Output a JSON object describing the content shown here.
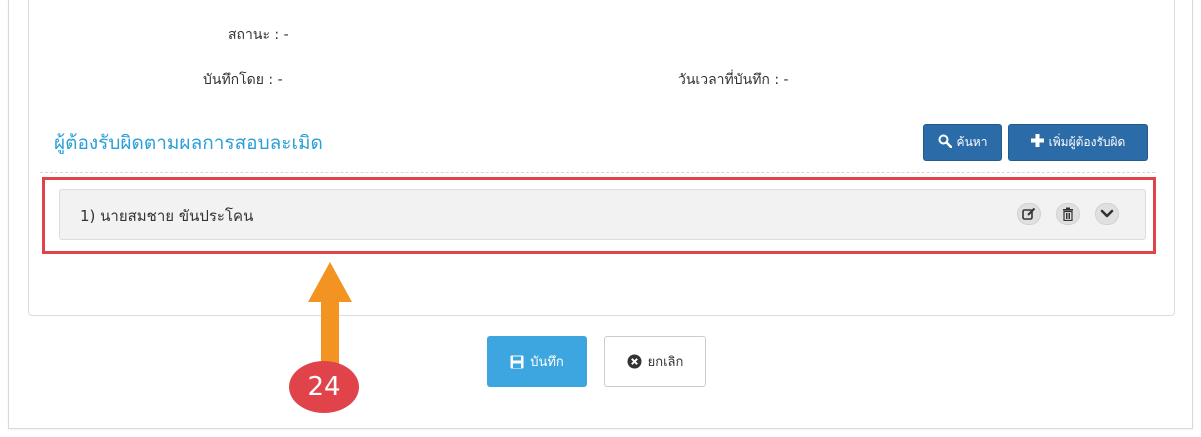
{
  "form": {
    "status_label": "สถานะ : -",
    "recorded_by_label": "บันทึกโดย : -",
    "recorded_at_label": "วันเวลาที่บันทึก : -"
  },
  "section": {
    "title": "ผู้ต้องรับผิดตามผลการสอบละเมิด",
    "search_label": "ค้นหา",
    "add_label": "เพิ่มผู้ต้องรับผิด"
  },
  "persons": [
    {
      "label": "1) นายสมชาย ขันประโคน"
    }
  ],
  "actions": {
    "save_label": "บันทึก",
    "cancel_label": "ยกเลิก"
  },
  "callout": {
    "number": "24"
  },
  "colors": {
    "title_blue": "#2a9fd8",
    "button_dark_blue": "#2b6ca8",
    "button_save_blue": "#3da6e0",
    "highlight_red": "#e0434a",
    "callout_orange": "#f39321"
  },
  "icons": [
    "search-icon",
    "plus-icon",
    "edit-icon",
    "trash-icon",
    "chevron-down-icon",
    "save-icon",
    "cancel-icon",
    "arrow-up-icon"
  ]
}
